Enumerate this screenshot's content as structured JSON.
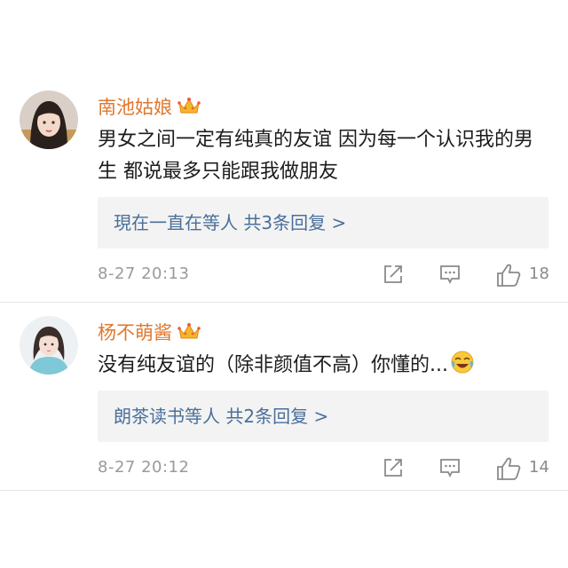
{
  "comments": [
    {
      "username": "南池姑娘",
      "text": "男女之间一定有纯真的友谊 因为每一个认识我的男生 都说最多只能跟我做朋友",
      "reply_summary": "現在一直在等人  共3条回复 >",
      "timestamp": "8-27 20:13",
      "like_count": "18",
      "has_vip_crown": true
    },
    {
      "username": "杨不萌酱",
      "text": "没有纯友谊的（除非颜值不高）你懂的...",
      "reply_summary": "朗茶读书等人  共2条回复 >",
      "timestamp": "8-27 20:12",
      "like_count": "14",
      "has_vip_crown": true,
      "trailing_emoji": "laugh-cry-emoji"
    }
  ],
  "colors": {
    "username": "#e0782f",
    "reply_link": "#4a6f9a",
    "meta_gray": "#9a9a9a",
    "reply_bg": "#f3f3f3"
  }
}
